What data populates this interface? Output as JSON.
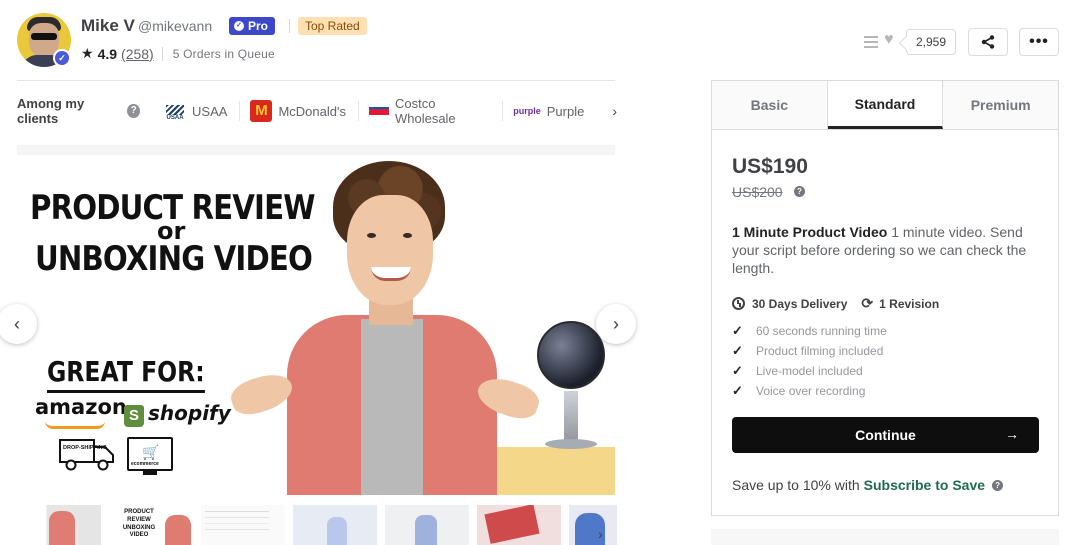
{
  "seller": {
    "name": "Mike V",
    "handle": "@mikevann",
    "pro_label": "Pro",
    "top_rated_label": "Top Rated",
    "rating": "4.9",
    "reviews_count": "(258)",
    "queue": "5 Orders in Queue",
    "avatar_icon": "avatar-image",
    "verified_icon": "check-badge-icon"
  },
  "clients": {
    "label": "Among my clients",
    "items": [
      {
        "name": "USAA",
        "icon": "usaa-logo"
      },
      {
        "name": "McDonald's",
        "icon": "mcdonalds-logo"
      },
      {
        "name": "Costco Wholesale",
        "icon": "costco-logo"
      },
      {
        "name": "Purple",
        "icon": "purple-logo",
        "logo_text": "purple"
      }
    ]
  },
  "gallery": {
    "slide": {
      "title_line1": "PRODUCT REVIEW",
      "title_or": "or",
      "title_line2": "UNBOXING VIDEO",
      "great_for": "GREAT FOR:",
      "brand1": "amazon",
      "brand2": "shopify",
      "brand2_mark": "S",
      "truck_text": "DROP-SHIPPING",
      "ecom_text": "ecommerce"
    },
    "thumb2_text": "PRODUCT REVIEW UNBOXING VIDEO"
  },
  "actions": {
    "likes": "2,959",
    "list_icon": "list-icon",
    "heart_icon": "heart-icon",
    "share_icon": "share-icon",
    "more_icon": "more-icon"
  },
  "package": {
    "tabs": [
      "Basic",
      "Standard",
      "Premium"
    ],
    "active_tab": "Standard",
    "price": "US$190",
    "old_price": "US$200",
    "title": "1 Minute Product Video",
    "description": "1 minute video. Send your script before ordering so we can check the length.",
    "delivery": "30 Days Delivery",
    "revisions": "1 Revision",
    "features": [
      "60 seconds running time",
      "Product filming included",
      "Live-model included",
      "Voice over recording"
    ],
    "continue_label": "Continue",
    "save_text": "Save up to 10% with",
    "save_link": "Subscribe to Save"
  },
  "colors": {
    "pro_badge": "#3c47c9",
    "top_rated_bg": "#ffe0b3",
    "continue_bg": "#0e0e0e",
    "link_green": "#1f6b4f"
  }
}
